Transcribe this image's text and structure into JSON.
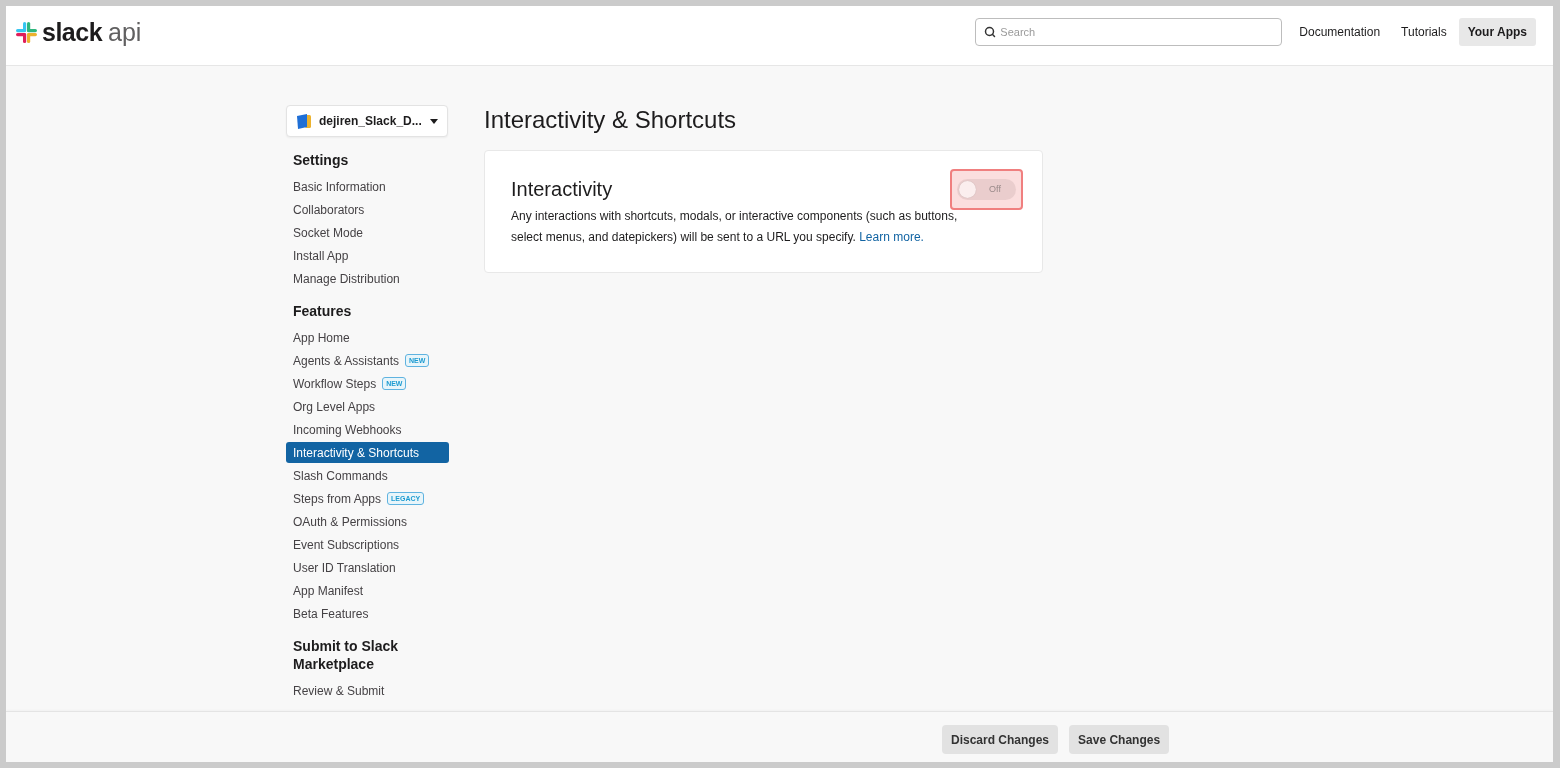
{
  "header": {
    "logo": {
      "brand": "slack",
      "suffix": "api"
    },
    "search": {
      "placeholder": "Search"
    },
    "nav": [
      {
        "label": "Documentation",
        "selected": false
      },
      {
        "label": "Tutorials",
        "selected": false
      },
      {
        "label": "Your Apps",
        "selected": true
      }
    ]
  },
  "sidebar": {
    "app_selector": {
      "name": "dejiren_Slack_D..."
    },
    "sections": [
      {
        "title": "Settings",
        "items": [
          {
            "label": "Basic Information",
            "selected": false
          },
          {
            "label": "Collaborators",
            "selected": false
          },
          {
            "label": "Socket Mode",
            "selected": false
          },
          {
            "label": "Install App",
            "selected": false
          },
          {
            "label": "Manage Distribution",
            "selected": false
          }
        ]
      },
      {
        "title": "Features",
        "items": [
          {
            "label": "App Home",
            "selected": false
          },
          {
            "label": "Agents & Assistants",
            "selected": false,
            "badge": "NEW"
          },
          {
            "label": "Workflow Steps",
            "selected": false,
            "badge": "NEW"
          },
          {
            "label": "Org Level Apps",
            "selected": false
          },
          {
            "label": "Incoming Webhooks",
            "selected": false
          },
          {
            "label": "Interactivity & Shortcuts",
            "selected": true
          },
          {
            "label": "Slash Commands",
            "selected": false
          },
          {
            "label": "Steps from Apps",
            "selected": false,
            "badge": "LEGACY"
          },
          {
            "label": "OAuth & Permissions",
            "selected": false
          },
          {
            "label": "Event Subscriptions",
            "selected": false
          },
          {
            "label": "User ID Translation",
            "selected": false
          },
          {
            "label": "App Manifest",
            "selected": false
          },
          {
            "label": "Beta Features",
            "selected": false
          }
        ]
      },
      {
        "title": "Submit to Slack Marketplace",
        "items": [
          {
            "label": "Review & Submit",
            "selected": false
          }
        ]
      }
    ]
  },
  "page": {
    "title": "Interactivity & Shortcuts",
    "card": {
      "title": "Interactivity",
      "description": "Any interactions with shortcuts, modals, or interactive components (such as buttons, select menus, and datepickers) will be sent to a URL you specify.",
      "link": "Learn more.",
      "toggle": {
        "label": "Off",
        "on": false,
        "highlighted": true
      }
    }
  },
  "footer": {
    "buttons": [
      {
        "label": "Discard Changes"
      },
      {
        "label": "Save Changes"
      }
    ]
  }
}
